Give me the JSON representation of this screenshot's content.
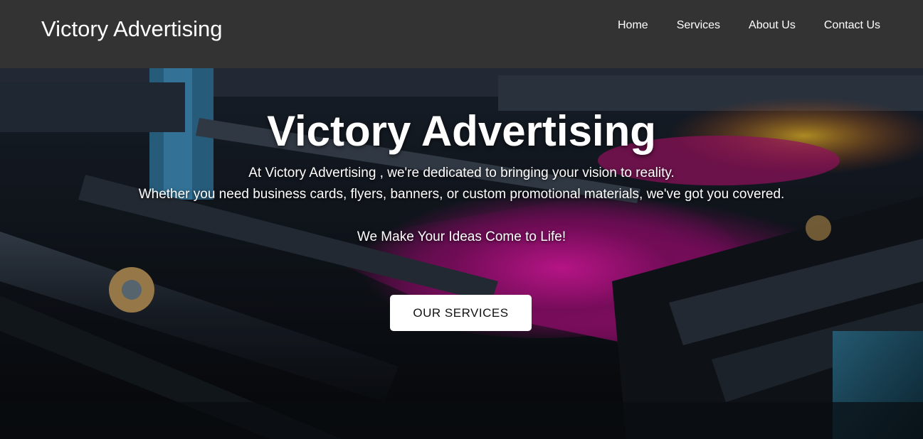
{
  "navbar": {
    "brand": "Victory Advertising",
    "links": [
      {
        "label": "Home"
      },
      {
        "label": "Services"
      },
      {
        "label": "About Us"
      },
      {
        "label": "Contact Us"
      }
    ]
  },
  "hero": {
    "title": "Victory Advertising",
    "line1": "At Victory Advertising , we're dedicated to bringing your vision to reality.",
    "line2": "Whether you need business cards, flyers, banners, or custom promotional materials, we've got you covered.",
    "tagline": "We Make Your Ideas Come to Life!",
    "cta_label": "OUR SERVICES"
  },
  "colors": {
    "navbar_bg": "#333333",
    "text": "#ffffff",
    "cta_bg": "#ffffff",
    "accent_magenta": "#c2158f"
  }
}
